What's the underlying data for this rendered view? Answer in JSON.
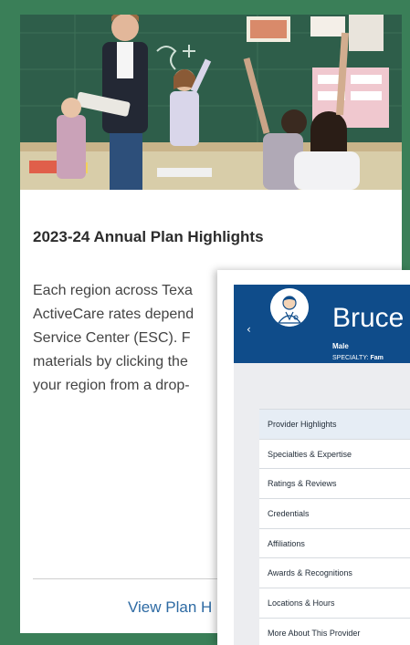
{
  "card": {
    "title": "2023-24 Annual Plan Highlights",
    "body_lines": [
      "Each region across Texa",
      "ActiveCare rates depend",
      "Service Center (ESC). F",
      "materials by clicking the",
      "your region from a drop-"
    ],
    "link_label": "View Plan H"
  },
  "provider": {
    "name": "Bruce",
    "gender": "Male",
    "specialty_label": "SPECIALTY:",
    "specialty_value": "Fam",
    "back_icon": "chevron-left-icon",
    "avatar_icon": "doctor-avatar-icon",
    "menu": [
      "Provider Highlights",
      "Specialties & Expertise",
      "Ratings & Reviews",
      "Credentials",
      "Affiliations",
      "Awards & Recognitions",
      "Locations & Hours",
      "More About This Provider"
    ],
    "active_menu_index": 0
  },
  "colors": {
    "frame_green": "#3a7f58",
    "header_blue": "#0f4c8a",
    "link_blue": "#2d6aa3"
  }
}
